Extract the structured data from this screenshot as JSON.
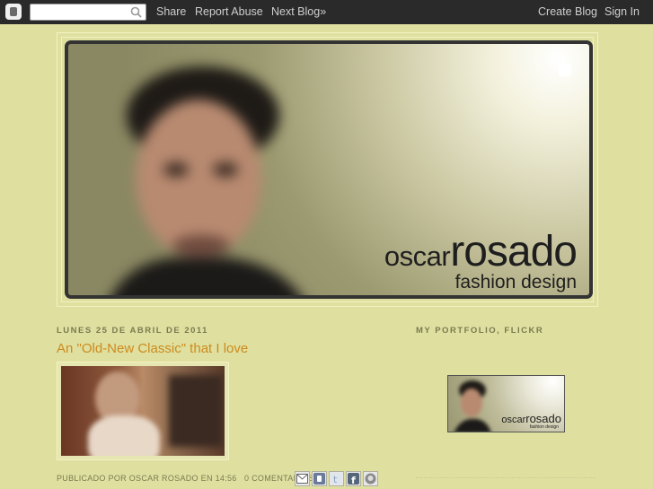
{
  "navbar": {
    "search_value": "",
    "links": {
      "share": "Share",
      "report_abuse": "Report Abuse",
      "next_blog": "Next Blog»",
      "create_blog": "Create Blog",
      "sign_in": "Sign In"
    }
  },
  "header": {
    "brand_first": "oscar",
    "brand_last": "rosado",
    "subtitle": "fashion design"
  },
  "post": {
    "date": "lunes 25 de abril de 2011",
    "title": "An \"Old-New Classic\" that I love",
    "footer": {
      "published_by": "Publicado por",
      "author": "Oscar Rosado",
      "at": "en",
      "time": "14:56",
      "comments": "0 comentarios"
    },
    "share_icons": [
      "email-icon",
      "blogger-icon",
      "twitter-icon",
      "facebook-icon",
      "buzz-icon"
    ]
  },
  "sidebar": {
    "title": "My Portfolio, Flickr",
    "thumb": {
      "brand_first": "oscar",
      "brand_last": "rosado",
      "subtitle": "fashion design"
    }
  },
  "colors": {
    "background": "#dfe0a0",
    "navbar": "#2a2a2a",
    "post_title": "#cc8a1e",
    "meta_text": "#7a7a50"
  }
}
